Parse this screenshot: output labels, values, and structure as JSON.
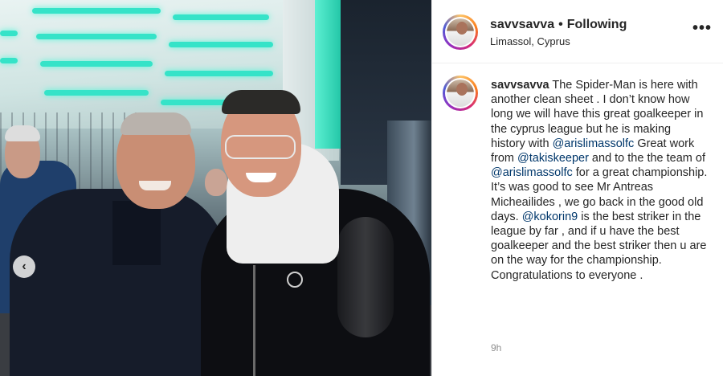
{
  "post": {
    "username": "savvsavva",
    "follow_state": "Following",
    "separator": "•",
    "location": "Limassol, Cyprus",
    "more_label": "•••",
    "timestamp": "9h"
  },
  "caption": {
    "author": "savvsavva",
    "parts": [
      {
        "type": "text",
        "value": " The Spider-Man is here with another clean sheet . I don’t know how long we will have this great goalkeeper in the cyprus league but he is making history with "
      },
      {
        "type": "mention",
        "value": "@arislimassolfc"
      },
      {
        "type": "text",
        "value": " Great work from "
      },
      {
        "type": "mention",
        "value": "@takiskeeper"
      },
      {
        "type": "text",
        "value": " and to the the team of "
      },
      {
        "type": "mention",
        "value": "@arislimassolfc"
      },
      {
        "type": "text",
        "value": " for a great championship. It’s was good to see Mr Antreas Micheailides , we go back in the good old days. "
      },
      {
        "type": "mention",
        "value": "@kokorin9"
      },
      {
        "type": "text",
        "value": " is the best striker in the league by far , and if u have the best goalkeeper and the best striker then u are on the way for the championship. Congratulations to everyone ."
      }
    ]
  },
  "carousel": {
    "prev_glyph": "‹"
  },
  "colors": {
    "link": "#00376b",
    "muted": "#8e8e8e",
    "text": "#262626",
    "divider": "#efefef"
  }
}
